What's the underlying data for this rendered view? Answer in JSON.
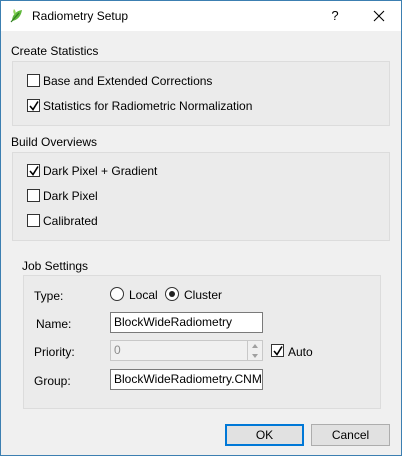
{
  "window": {
    "title": "Radiometry Setup",
    "help_label": "?",
    "icon": "radiometry-leaf-icon",
    "accent_color": "#3c7fb1"
  },
  "create_statistics": {
    "title": "Create Statistics",
    "options": [
      {
        "label": "Base and Extended Corrections",
        "checked": false
      },
      {
        "label": "Statistics for Radiometric Normalization",
        "checked": true
      }
    ]
  },
  "build_overviews": {
    "title": "Build Overviews",
    "options": [
      {
        "label": "Dark Pixel + Gradient",
        "checked": true
      },
      {
        "label": "Dark Pixel",
        "checked": false
      },
      {
        "label": "Calibrated",
        "checked": false
      }
    ]
  },
  "job_settings": {
    "title": "Job Settings",
    "type_label": "Type:",
    "type_options": [
      {
        "label": "Local",
        "selected": false
      },
      {
        "label": "Cluster",
        "selected": true
      }
    ],
    "name_label": "Name:",
    "name_value": "BlockWideRadiometry",
    "priority_label": "Priority:",
    "priority_value": "0",
    "auto_label": "Auto",
    "auto_checked": true,
    "group_label": "Group:",
    "group_value": "BlockWideRadiometry.CNM"
  },
  "buttons": {
    "ok": "OK",
    "cancel": "Cancel"
  }
}
